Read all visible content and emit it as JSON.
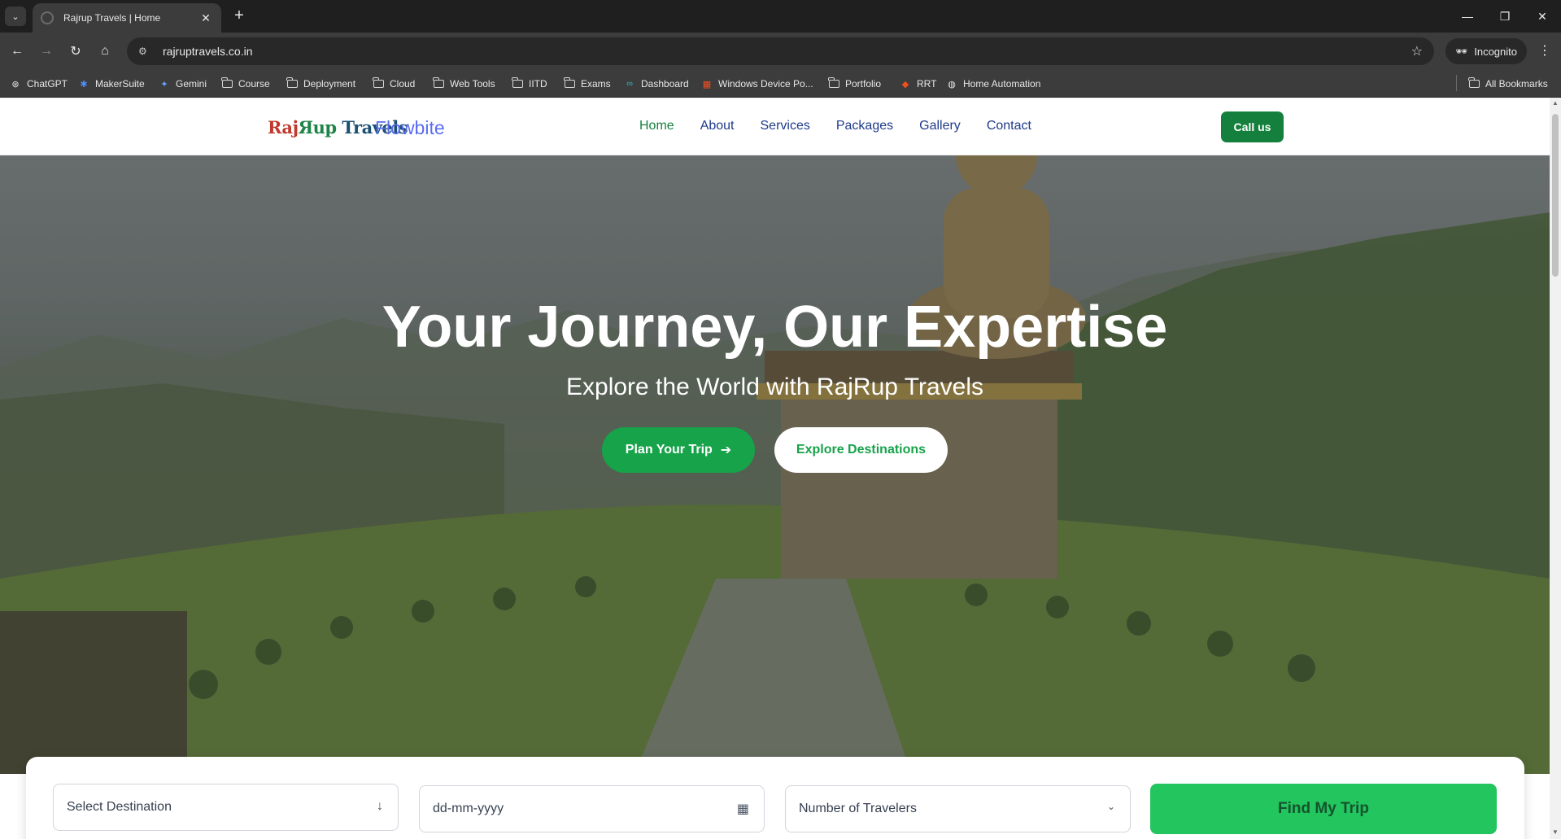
{
  "browser": {
    "tab_title": "Rajrup Travels | Home",
    "url": "rajruptravels.co.in",
    "incognito_label": "Incognito",
    "bookmarks": [
      {
        "label": "ChatGPT",
        "icon": "chatgpt-icon"
      },
      {
        "label": "MakerSuite",
        "icon": "makersuite-icon"
      },
      {
        "label": "Gemini",
        "icon": "gemini-icon"
      },
      {
        "label": "Course",
        "icon": "folder-icon"
      },
      {
        "label": "Deployment",
        "icon": "folder-icon"
      },
      {
        "label": "Cloud",
        "icon": "folder-icon"
      },
      {
        "label": "Web Tools",
        "icon": "folder-icon"
      },
      {
        "label": "IITD",
        "icon": "folder-icon"
      },
      {
        "label": "Exams",
        "icon": "folder-icon"
      },
      {
        "label": "Dashboard",
        "icon": "dashboard-icon"
      },
      {
        "label": "Windows Device Po...",
        "icon": "windows-icon"
      },
      {
        "label": "Portfolio",
        "icon": "folder-icon"
      },
      {
        "label": "RRT",
        "icon": "figma-icon"
      },
      {
        "label": "Home Automation",
        "icon": "globe-icon"
      }
    ],
    "all_bookmarks_label": "All Bookmarks"
  },
  "site": {
    "logo": {
      "part1": "Raj",
      "part2": "Яup",
      "part3": " Travels"
    },
    "brand": "Flowbite",
    "nav": [
      "Home",
      "About",
      "Services",
      "Packages",
      "Gallery",
      "Contact"
    ],
    "active_nav": "Home",
    "call_button": "Call us"
  },
  "hero": {
    "title": "Your Journey, Our Expertise",
    "subtitle": "Explore the World with RajRup Travels",
    "primary_button": "Plan Your Trip",
    "secondary_button": "Explore Destinations"
  },
  "search": {
    "destination_placeholder": "Select Destination",
    "date_placeholder": "dd-mm-yyyy",
    "travelers_placeholder": "Number of Travelers",
    "submit_label": "Find My Trip"
  },
  "colors": {
    "primary_green": "#16a34a",
    "nav_blue": "#1e3a8a",
    "brand_purple": "#5b6df2"
  }
}
